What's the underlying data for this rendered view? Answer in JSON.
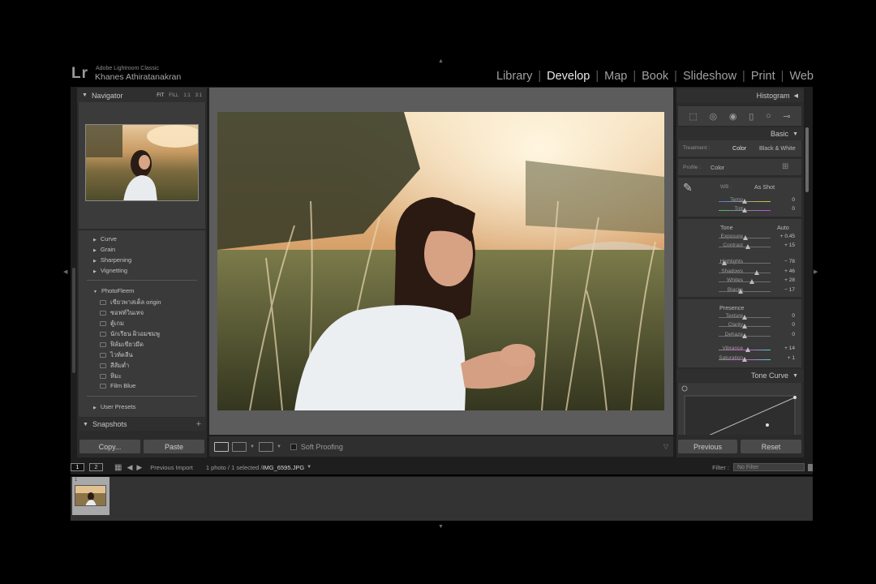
{
  "identity": {
    "logo": "Lr",
    "app_name": "Adobe Lightroom Classic",
    "user_name": "Khanes Athiratanakran"
  },
  "modules": [
    "Library",
    "Develop",
    "Map",
    "Book",
    "Slideshow",
    "Print",
    "Web"
  ],
  "active_module": "Develop",
  "navigator": {
    "title": "Navigator",
    "options": [
      "FIT",
      "FILL",
      "1:1",
      "3:1"
    ]
  },
  "presets": {
    "groups": [
      "Curve",
      "Grain",
      "Sharpening",
      "Vignetting"
    ],
    "folder": "PhotoFleem",
    "items": [
      "เขียวพาสเต็ล origin",
      "ซอฟท์วินเทจ",
      "ตู้เกม",
      "นักเรียน ผิวอมชมพู",
      "ฟิล์มเขียวมืด",
      "ไวท์คลีน",
      "สีส้มต่ำ",
      "หิมะ",
      "Film Blue"
    ],
    "user_presets": "User Presets"
  },
  "snapshots": {
    "title": "Snapshots",
    "add": "+"
  },
  "left_buttons": {
    "copy": "Copy...",
    "paste": "Paste"
  },
  "toolbar": {
    "soft_proofing": "Soft Proofing"
  },
  "histogram": {
    "title": "Histogram"
  },
  "basic": {
    "title": "Basic",
    "treatment_label": "Treatment :",
    "treatment_color": "Color",
    "treatment_bw": "Black & White",
    "profile_label": "Profile :",
    "profile_value": "Color",
    "wb_label": "WB :",
    "wb_value": "As Shot",
    "tone_label": "Tone",
    "tone_auto": "Auto",
    "presence_label": "Presence",
    "sliders": [
      {
        "name": "Temp",
        "value": "0",
        "pos": 0.5
      },
      {
        "name": "Tint",
        "value": "0",
        "pos": 0.5
      },
      {
        "name": "Exposure",
        "value": "+ 0.45",
        "pos": 0.52
      },
      {
        "name": "Contrast",
        "value": "+ 15",
        "pos": 0.57
      },
      {
        "name": "Highlights",
        "value": "− 78",
        "pos": 0.11
      },
      {
        "name": "Shadows",
        "value": "+ 46",
        "pos": 0.73
      },
      {
        "name": "Whites",
        "value": "+ 28",
        "pos": 0.64
      },
      {
        "name": "Blacks",
        "value": "− 17",
        "pos": 0.42
      },
      {
        "name": "Texture",
        "value": "0",
        "pos": 0.5
      },
      {
        "name": "Clarity",
        "value": "0",
        "pos": 0.5
      },
      {
        "name": "Dehaze",
        "value": "0",
        "pos": 0.5
      },
      {
        "name": "Vibrance",
        "value": "+ 14",
        "pos": 0.57
      },
      {
        "name": "Saturation",
        "value": "+ 1",
        "pos": 0.5
      }
    ]
  },
  "tone_curve": {
    "title": "Tone Curve"
  },
  "right_buttons": {
    "previous": "Previous",
    "reset": "Reset"
  },
  "filmstrip": {
    "screen1": "1",
    "screen2": "2",
    "source": "Previous Import",
    "count": "1 photo / 1 selected /",
    "filename": "IMG_6595.JPG",
    "filter_label": "Filter :",
    "filter_value": "No Filter",
    "thumb_index": "1"
  }
}
